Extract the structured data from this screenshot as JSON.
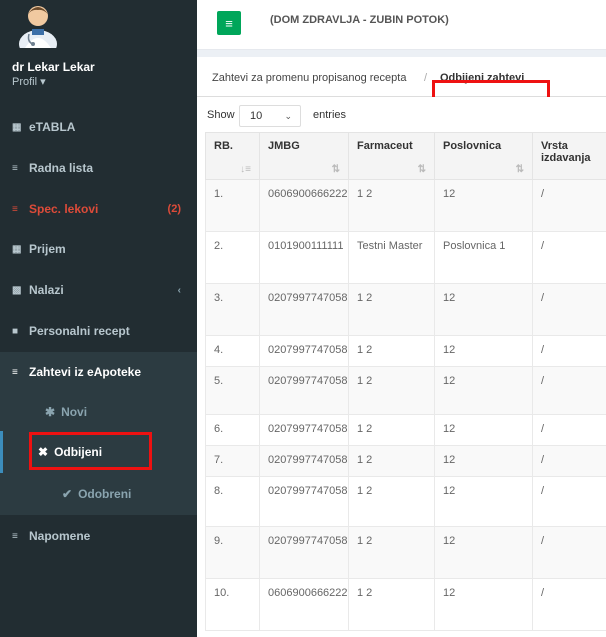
{
  "user": {
    "name": "dr Lekar Lekar",
    "profile_label": "Profil ▾"
  },
  "header": {
    "menu_icon": "hamburger-icon",
    "clinic": "(DOM ZDRAVLJA - ZUBIN POTOK)"
  },
  "breadcrumb": {
    "parent": "Zahtevi za promenu propisanog recepta",
    "current": "Odbijeni zahtevi"
  },
  "sidebar": {
    "items": [
      {
        "label": "eTABLA",
        "icon": "▦"
      },
      {
        "label": "Radna lista",
        "icon": "≡"
      },
      {
        "label": "Spec. lekovi",
        "icon": "≡",
        "badge": "(2)"
      },
      {
        "label": "Prijem",
        "icon": "▦"
      },
      {
        "label": "Nalazi",
        "icon": "▩",
        "chevron": "‹"
      },
      {
        "label": "Personalni recept",
        "icon": "■"
      },
      {
        "label": "Zahtevi iz eApoteke",
        "icon": "≡"
      },
      {
        "label": "Napomene",
        "icon": "≡"
      }
    ],
    "submenu": [
      {
        "label": "Novi",
        "icon": "✱"
      },
      {
        "label": "Odbijeni",
        "icon": "✖"
      },
      {
        "label": "Odobreni",
        "icon": "✔"
      }
    ]
  },
  "table": {
    "show_label": "Show",
    "entries_value": "10",
    "entries_label": "entries",
    "columns": [
      "RB.",
      "JMBG",
      "Farmaceut",
      "Poslovnica",
      "Vrsta izdavanja"
    ],
    "rows": [
      [
        "1.",
        "0606900666222",
        "1 2",
        "12",
        "/"
      ],
      [
        "2.",
        "0101900111111",
        "Testni Master",
        "Poslovnica 1",
        "/"
      ],
      [
        "3.",
        "0207997747058",
        "1 2",
        "12",
        "/"
      ],
      [
        "4.",
        "0207997747058",
        "1 2",
        "12",
        "/"
      ],
      [
        "5.",
        "0207997747058",
        "1 2",
        "12",
        "/"
      ],
      [
        "6.",
        "0207997747058",
        "1 2",
        "12",
        "/"
      ],
      [
        "7.",
        "0207997747058",
        "1 2",
        "12",
        "/"
      ],
      [
        "8.",
        "0207997747058",
        "1 2",
        "12",
        "/"
      ],
      [
        "9.",
        "0207997747058",
        "1 2",
        "12",
        "/"
      ],
      [
        "10.",
        "0606900666222",
        "1 2",
        "12",
        "/"
      ]
    ]
  }
}
